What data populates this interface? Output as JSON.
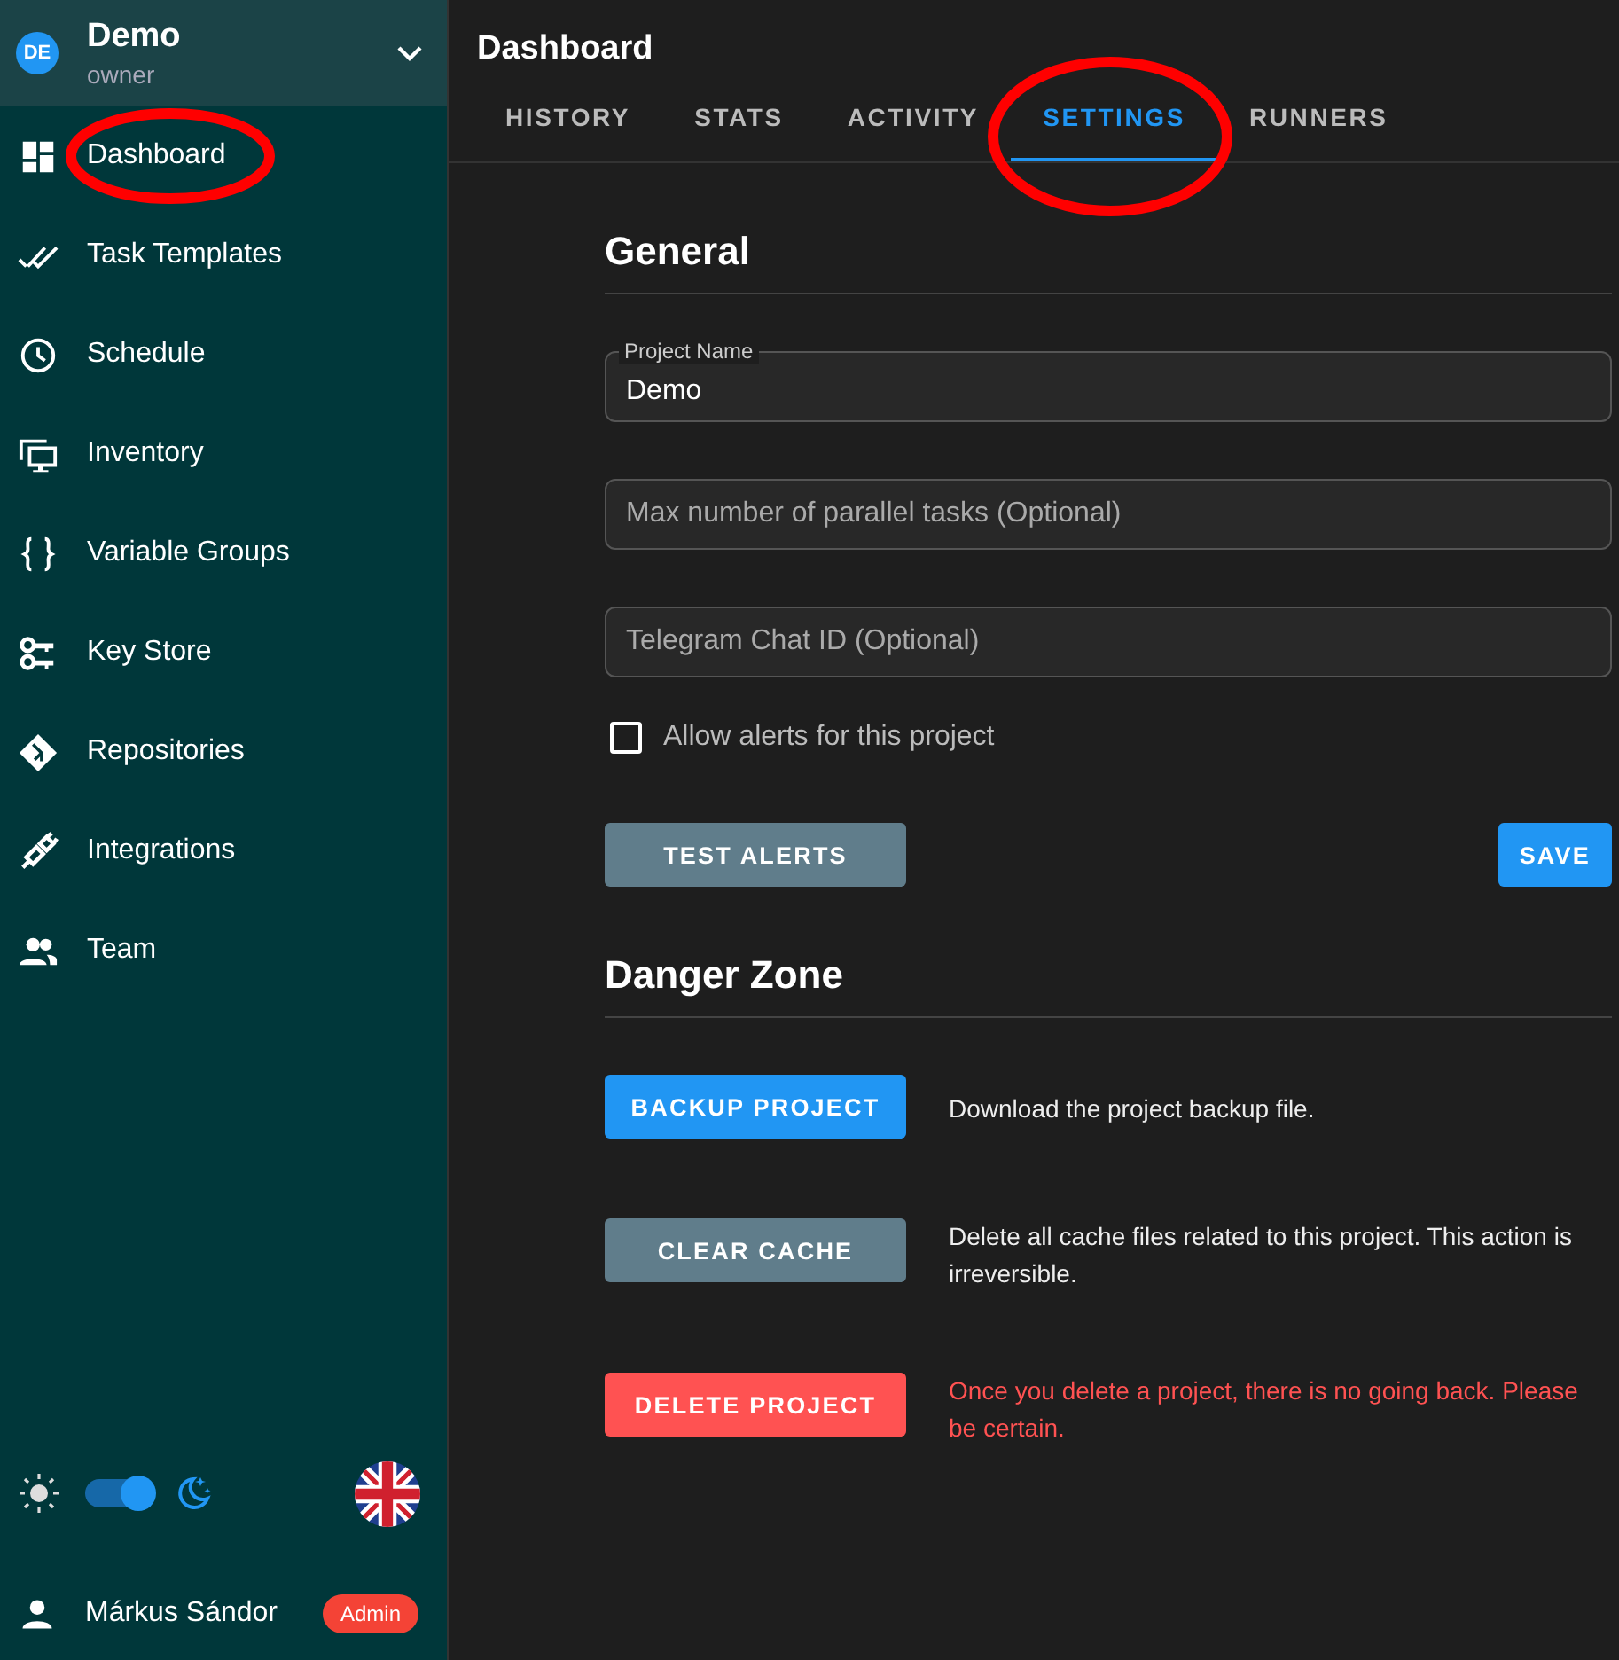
{
  "project": {
    "initials": "DE",
    "name": "Demo",
    "role": "owner"
  },
  "nav": [
    {
      "label": "Dashboard",
      "circled": true
    },
    {
      "label": "Task Templates",
      "circled": false
    },
    {
      "label": "Schedule",
      "circled": false
    },
    {
      "label": "Inventory",
      "circled": false
    },
    {
      "label": "Variable Groups",
      "circled": false
    },
    {
      "label": "Key Store",
      "circled": false
    },
    {
      "label": "Repositories",
      "circled": false
    },
    {
      "label": "Integrations",
      "circled": false
    },
    {
      "label": "Team",
      "circled": false
    }
  ],
  "theme_switch": {
    "on": true
  },
  "user": {
    "name": "Márkus Sándor",
    "badge": "Admin"
  },
  "page_title": "Dashboard",
  "tabs": [
    {
      "label": "HISTORY",
      "selected": false,
      "circled": false
    },
    {
      "label": "STATS",
      "selected": false,
      "circled": false
    },
    {
      "label": "ACTIVITY",
      "selected": false,
      "circled": false
    },
    {
      "label": "SETTINGS",
      "selected": true,
      "circled": true
    },
    {
      "label": "RUNNERS",
      "selected": false,
      "circled": false
    }
  ],
  "general": {
    "title": "General",
    "fields": [
      {
        "label": "Project Name",
        "value": "Demo"
      },
      {
        "placeholder": "Max number of parallel tasks (Optional)"
      },
      {
        "placeholder": "Telegram Chat ID (Optional)"
      }
    ],
    "checkbox": {
      "label": "Allow alerts for this project",
      "checked": false
    },
    "buttons": [
      {
        "label": "TEST ALERTS",
        "kind": "secondary"
      },
      {
        "label": "SAVE",
        "kind": "primary"
      }
    ]
  },
  "danger_zone": {
    "title": "Danger Zone",
    "actions": [
      {
        "label": "BACKUP PROJECT",
        "kind": "primary",
        "description": "Download the project backup file."
      },
      {
        "label": "CLEAR CACHE",
        "kind": "secondary",
        "description": "Delete all cache files related to this project. This action is irreversible."
      },
      {
        "label": "DELETE PROJECT",
        "kind": "danger",
        "description": "Once you delete a project, there is no going back. Please be certain."
      }
    ]
  }
}
